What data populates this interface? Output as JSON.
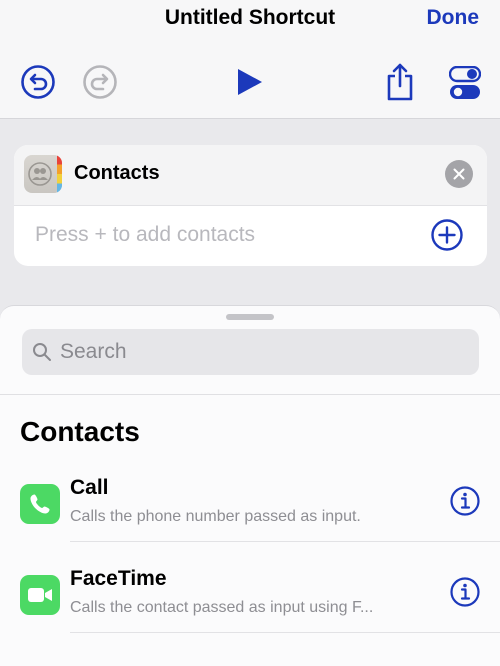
{
  "header": {
    "title": "Untitled Shortcut",
    "done_label": "Done"
  },
  "toolbar": {
    "icons": [
      "undo-icon",
      "redo-icon",
      "play-icon",
      "share-icon",
      "settings-toggle-icon"
    ],
    "accent_color": "#1c39bb",
    "disabled_color": "#b5b5b9"
  },
  "action_card": {
    "title": "Contacts",
    "placeholder": "Press + to add contacts"
  },
  "sheet": {
    "search_placeholder": "Search",
    "section_title": "Contacts",
    "actions": [
      {
        "title": "Call",
        "subtitle": "Calls the phone number passed as input.",
        "icon": "phone-icon",
        "color": "#4cd964"
      },
      {
        "title": "FaceTime",
        "subtitle": "Calls the contact passed as input using F...",
        "icon": "video-camera-icon",
        "color": "#4cd964"
      }
    ]
  }
}
